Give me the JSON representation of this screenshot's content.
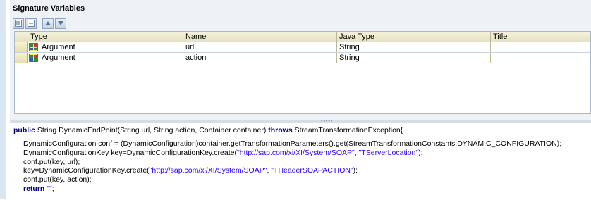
{
  "panel": {
    "title": "Signature Variables"
  },
  "toolbar": {
    "buttons": [
      "add-row-icon",
      "remove-row-icon",
      "move-up-icon",
      "move-down-icon"
    ]
  },
  "table": {
    "columns": [
      "Type",
      "Name",
      "Java Type",
      "Title"
    ],
    "rows": [
      {
        "type": "Argument",
        "name": "url",
        "java_type": "String",
        "title": ""
      },
      {
        "type": "Argument",
        "name": "action",
        "java_type": "String",
        "title": ""
      }
    ]
  },
  "code": {
    "sig_kw1": "public",
    "sig_mid": " String DynamicEndPoint(String url, String action, Container container) ",
    "sig_kw2": "throws",
    "sig_end": " StreamTransformationException{",
    "line1": "DynamicConfiguration conf = (DynamicConfiguration)container.getTransformationParameters().get(StreamTransformationConstants.DYNAMIC_CONFIGURATION);",
    "line2_pre": "DynamicConfigurationKey key=DynamicConfigurationKey.create(",
    "line2_s1": "\"http://sap.com/xi/XI/System/SOAP\"",
    "line2_mid": ", ",
    "line2_s2": "\"TServerLocation\"",
    "line2_end": ");",
    "line3": "conf.put(key, url);",
    "line4_pre": "key=DynamicConfigurationKey.create(",
    "line4_s1": "\"http://sap.com/xi/XI/System/SOAP\"",
    "line4_mid": ", ",
    "line4_s2": "\"THeaderSOAPACTION\"",
    "line4_end": ");",
    "line5": "conf.put(key, action);",
    "line6_kw": "return",
    "line6_sp": " ",
    "line6_str": "\"\"",
    "line6_end": ";"
  },
  "colors": {
    "keyword": "#00007f",
    "string": "#2a00ff",
    "header_bg": "#e6e3bf"
  }
}
